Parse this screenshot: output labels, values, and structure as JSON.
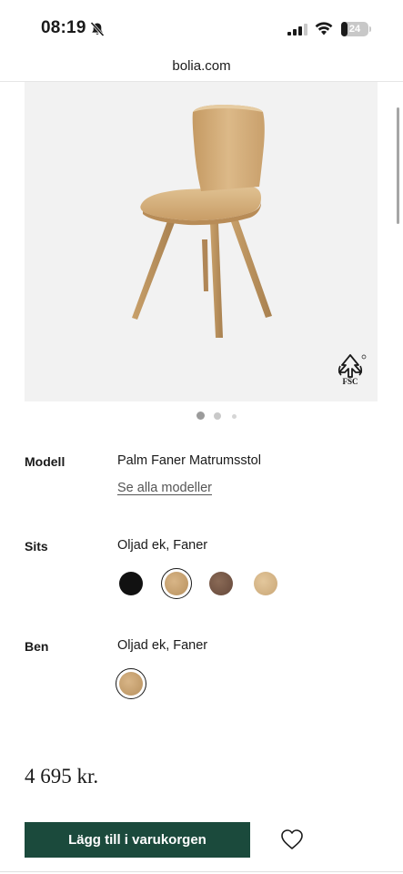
{
  "status_bar": {
    "time": "08:19",
    "battery": "24",
    "battery_level": 0.24
  },
  "browser": {
    "url": "bolia.com"
  },
  "product_image": {
    "alt": "chair",
    "fsc_label": "FSC",
    "carousel_total": 3,
    "carousel_active": 1
  },
  "model": {
    "label": "Modell",
    "value": "Palm Faner Matrumsstol",
    "see_all": "Se alla modeller"
  },
  "seat": {
    "label": "Sits",
    "value": "Oljad ek, Faner",
    "swatches": [
      {
        "name": "black",
        "color": "#111111"
      },
      {
        "name": "oak",
        "color": "#caa577",
        "selected": true
      },
      {
        "name": "walnut",
        "color": "#7a5a48"
      },
      {
        "name": "light-oak",
        "color": "#d8b98a"
      }
    ]
  },
  "legs": {
    "label": "Ben",
    "value": "Oljad ek, Faner",
    "swatches": [
      {
        "name": "oak",
        "color": "#caa577",
        "selected": true
      }
    ]
  },
  "price": "4 695 kr.",
  "actions": {
    "add_to_cart": "Lägg till i varukorgen"
  },
  "colors": {
    "button": "#1b4a3c",
    "image_background": "#f2f2f2"
  }
}
